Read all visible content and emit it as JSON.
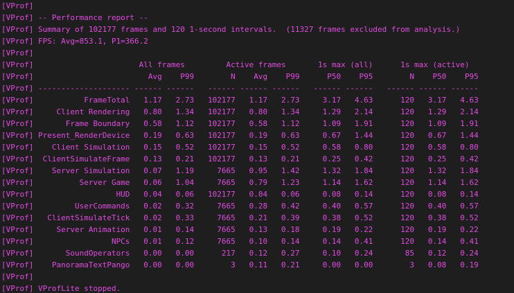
{
  "console": {
    "lines": [
      "[VProf]",
      "[VProf] -- Performance report --",
      "[VProf] Summary of 102177 frames and 120 1-second intervals.  (11327 frames excluded from analysis.)",
      "[VProf] FPS: Avg=853.1, P1=366.2",
      "[VProf]",
      "[VProf]                       All frames         Active frames       1s max (all)      1s max (active)",
      "[VProf]                         Avg    P99        N    Avg    P99      P50    P95        N    P50    P95",
      "[VProf] -------------------- ------ ------   ------ ------ ------   ------ ------   ------ ------ ------",
      "[VProf]           FrameTotal   1.17   2.73   102177   1.17   2.73     3.17   4.63      120   3.17   4.63",
      "[VProf]     Client Rendering   0.80   1.34   102177   0.80   1.34     1.29   2.14      120   1.29   2.14",
      "[VProf]       Frame Boundary   0.58   1.12   102177   0.58   1.12     1.09   1.91      120   1.09   1.91",
      "[VProf] Present_RenderDevice   0.19   0.63   102177   0.19   0.63     0.67   1.44      120   0.67   1.44",
      "[VProf]    Client Simulation   0.15   0.52   102177   0.15   0.52     0.58   0.80      120   0.58   0.80",
      "[VProf]  ClientSimulateFrame   0.13   0.21   102177   0.13   0.21     0.25   0.42      120   0.25   0.42",
      "[VProf]    Server Simulation   0.07   1.19     7665   0.95   1.42     1.32   1.84      120   1.32   1.84",
      "[VProf]          Server Game   0.06   1.04     7665   0.79   1.23     1.14   1.62      120   1.14   1.62",
      "[VProf]                  HUD   0.04   0.06   102177   0.04   0.06     0.08   0.14      120   0.08   0.14",
      "[VProf]         UserCommands   0.02   0.32     7665   0.28   0.42     0.40   0.57      120   0.40   0.57",
      "[VProf]   ClientSimulateTick   0.02   0.33     7665   0.21   0.39     0.38   0.52      120   0.38   0.52",
      "[VProf]     Server Animation   0.01   0.14     7665   0.13   0.18     0.19   0.22      120   0.19   0.22",
      "[VProf]                 NPCs   0.01   0.12     7665   0.10   0.14     0.14   0.41      120   0.14   0.41",
      "[VProf]       SoundOperators   0.00   0.00      217   0.12   0.27     0.10   0.24       85   0.12   0.24",
      "[VProf]    PanoramaTextPango   0.00   0.00        3   0.11   0.21     0.00   0.00        3   0.08   0.19",
      "[VProf]",
      "[VProf] VProfLite stopped."
    ]
  }
}
